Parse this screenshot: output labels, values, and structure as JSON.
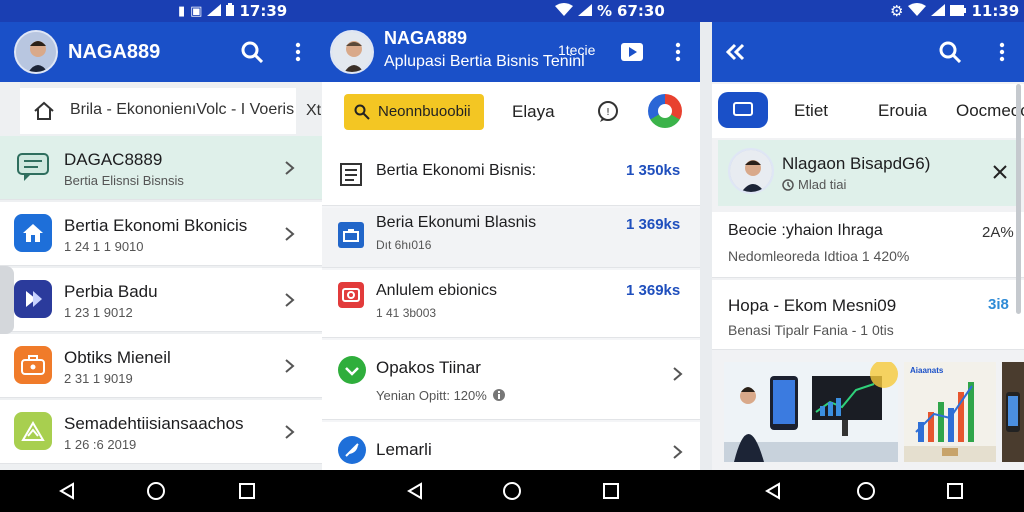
{
  "status": {
    "left_time": "17:39",
    "center_battery": "%",
    "center_time": "67:30",
    "right_time": "11:39"
  },
  "colors": {
    "appbar": "#1a50c8",
    "statusbar": "#1a3fb3",
    "accent_yellow": "#f3c623",
    "highlight": "#dff0ea",
    "value_blue": "#1f4fbd"
  },
  "panel1": {
    "title": "NAGA889",
    "breadcrumb": "Brila - EkononienıVolc - I Voeris",
    "breadcrumb_overflow": "Xt",
    "items": [
      {
        "title": "DAGAC8889",
        "sub": "Bertia Elisnsi Bisnsis",
        "icon": "chat-bubble-icon"
      },
      {
        "title": "Bertia Ekonomi Bkonicis",
        "sub": "1 24 1 1 9010",
        "icon": "home-icon"
      },
      {
        "title": "Perbia Badu",
        "sub": "1 23 1 9012",
        "icon": "flag-icon"
      },
      {
        "title": "Obtiks Mieneil",
        "sub": "2 31 1 9019",
        "icon": "briefcase-icon"
      },
      {
        "title": "Semadehtiisiansaachos",
        "sub": "1 26 :6 2019",
        "icon": "chart-up-icon"
      }
    ]
  },
  "panel2": {
    "title": "NAGA889",
    "subtitle": "Aplupasi Bertia Bisnis Teninl",
    "tag": "1tecie",
    "search_label": "Neonnbuoobii",
    "tab_label": "Elaya",
    "items": [
      {
        "title": "Bertia Ekonomi Bisnis:",
        "sub": "",
        "value": "1 350ks",
        "icon": "document-icon"
      },
      {
        "title": "Beria Ekonumi Blasnis",
        "sub": "Dıt 6hı016",
        "value": "1 369ks",
        "icon": "inbox-icon"
      },
      {
        "title": "Anlulem ebionics",
        "sub": "1 41 3b003",
        "value": "1 369ks",
        "icon": "camera-icon"
      },
      {
        "title": "Opakos Tiinar",
        "sub": "Yenian Opitt: 120%",
        "value": "",
        "icon": "check-circle-icon"
      },
      {
        "title": "Lemarli",
        "sub": "",
        "value": "",
        "icon": "feather-icon"
      }
    ]
  },
  "panel3": {
    "tabs": [
      "Etiet",
      "Erouia",
      "Oocmeoo"
    ],
    "profile_name": "Nlagaon BisapdG6)",
    "profile_sub": "Mlad tiai",
    "items": [
      {
        "title": "Beocie :yhaion Ihraga",
        "sub": "Nedomleoreda Idtioa 1 420%",
        "value": "2A%"
      },
      {
        "title": "Hopa - Ekom Mesni09",
        "sub": "Benasi Tipalr Fania - 1 0tis",
        "value": "3i8"
      }
    ],
    "promo_badge": "Aiaanats"
  }
}
